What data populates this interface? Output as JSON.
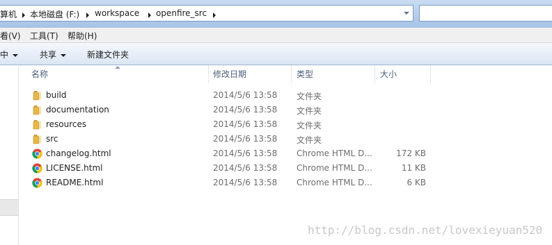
{
  "address": {
    "crumbs": [
      "算机",
      "本地磁盘 (F:)",
      "workspace",
      "openfire_src"
    ]
  },
  "menu": {
    "items": [
      "看(V)",
      "工具(T)",
      "帮助(H)"
    ]
  },
  "toolbar": {
    "include_label": "中",
    "share_label": "共享",
    "new_folder_label": "新建文件夹"
  },
  "columns": {
    "name": "名称",
    "date": "修改日期",
    "type": "类型",
    "size": "大小"
  },
  "files": [
    {
      "name": "build",
      "date": "2014/5/6 13:58",
      "type": "文件夹",
      "size": "",
      "icon": "folder-icon"
    },
    {
      "name": "documentation",
      "date": "2014/5/6 13:58",
      "type": "文件夹",
      "size": "",
      "icon": "folder-icon"
    },
    {
      "name": "resources",
      "date": "2014/5/6 13:58",
      "type": "文件夹",
      "size": "",
      "icon": "folder-icon"
    },
    {
      "name": "src",
      "date": "2014/5/6 13:58",
      "type": "文件夹",
      "size": "",
      "icon": "folder-icon"
    },
    {
      "name": "changelog.html",
      "date": "2014/5/6 13:58",
      "type": "Chrome HTML D...",
      "size": "172 KB",
      "icon": "chrome-html-icon"
    },
    {
      "name": "LICENSE.html",
      "date": "2014/5/6 13:58",
      "type": "Chrome HTML D...",
      "size": "11 KB",
      "icon": "chrome-html-icon"
    },
    {
      "name": "README.html",
      "date": "2014/5/6 13:58",
      "type": "Chrome HTML D...",
      "size": "6 KB",
      "icon": "chrome-html-icon"
    }
  ],
  "watermark": "http://blog.csdn.net/lovexieyuan520",
  "colors": {
    "folder": "#e8b84a",
    "chrome_red": "#db4437",
    "chrome_yellow": "#f4c20d",
    "chrome_green": "#0f9d58",
    "chrome_blue": "#4285f4"
  }
}
